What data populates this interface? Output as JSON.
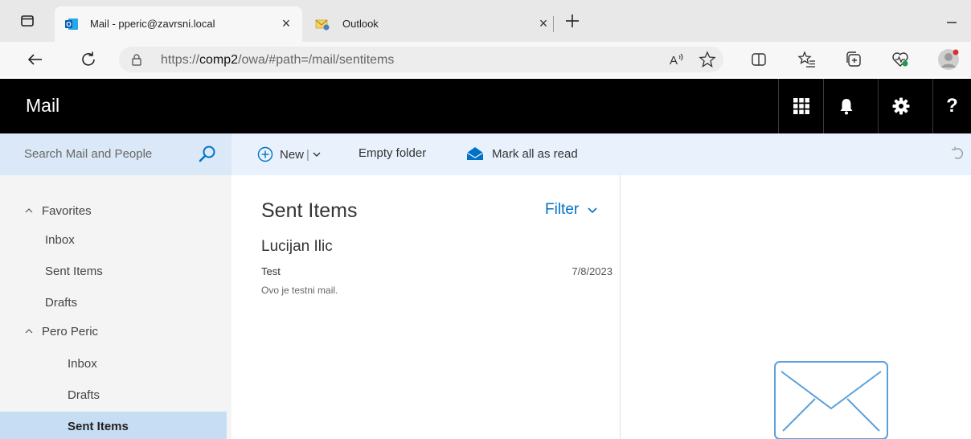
{
  "browser": {
    "tabs": [
      {
        "title": "Mail - pperic@zavrsni.local",
        "active": true,
        "favicon": "outlook-icon"
      },
      {
        "title": "Outlook",
        "active": false,
        "favicon": "outlook-envelope-icon"
      }
    ],
    "url_prefix": "https://",
    "url_host": "comp2",
    "url_path": "/owa/#path=/mail/sentitems"
  },
  "owa": {
    "app_title": "Mail",
    "header_buttons": [
      "app-launcher-icon",
      "bell-icon",
      "gear-icon",
      "help-icon"
    ],
    "help_label": "?"
  },
  "commandbar": {
    "search_placeholder": "Search Mail and People",
    "new_label": "New",
    "new_separator": "|",
    "empty_folder_label": "Empty folder",
    "mark_all_read_label": "Mark all as read"
  },
  "folders": {
    "favorites_label": "Favorites",
    "favorites": [
      "Inbox",
      "Sent Items",
      "Drafts"
    ],
    "account_label": "Pero Peric",
    "account_folders": [
      "Inbox",
      "Drafts",
      "Sent Items"
    ],
    "selected": "Sent Items"
  },
  "messagelist": {
    "heading": "Sent Items",
    "filter_label": "Filter",
    "messages": [
      {
        "sender": "Lucijan Ilic",
        "subject": "Test",
        "date": "7/8/2023",
        "preview": "Ovo je testni mail."
      }
    ]
  },
  "colors": {
    "header_bg": "#000000",
    "accent": "#0072c6",
    "command_bar_bg": "#e9f2fc",
    "selected_folder_bg": "#c7ddf3"
  }
}
